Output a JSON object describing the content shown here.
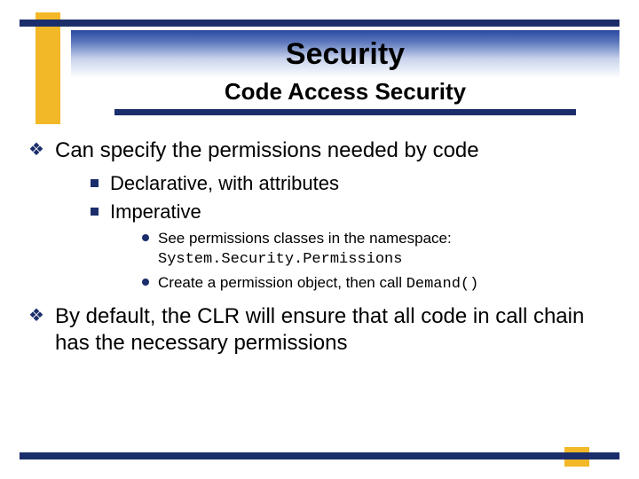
{
  "header": {
    "title": "Security",
    "subtitle": "Code Access Security"
  },
  "bullets": {
    "b1": "Can specify the permissions needed by code",
    "b1_1": "Declarative, with attributes",
    "b1_2": "Imperative",
    "b1_2_1a": "See permissions classes in the namespace: ",
    "b1_2_1b": "System.Security.Permissions",
    "b1_2_2a": "Create a permission object, then call ",
    "b1_2_2b": "Demand()",
    "b2": "By default, the CLR will ensure that all code in call chain has the necessary permissions"
  },
  "markers": {
    "level1": "❖"
  }
}
